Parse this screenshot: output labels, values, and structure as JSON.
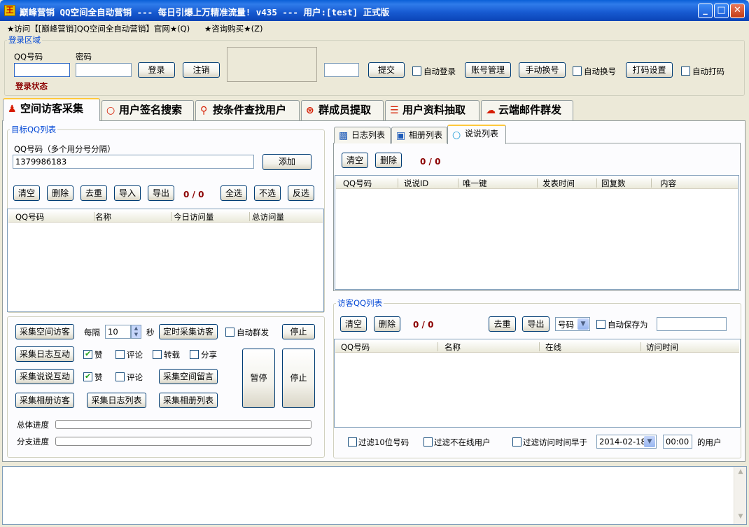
{
  "window": {
    "title": "巅峰营销 QQ空间全自动营销 --- 每日引爆上万精准流量! v435 --- 用户:[test] 正式版",
    "minimize": "_",
    "maximize": "□",
    "close": "✕"
  },
  "menu": {
    "item1": "★访问【[巅峰营销]QQ空间全自动营销】官网★(Q)",
    "item2": "★咨询购买★(Z)"
  },
  "login": {
    "group_title": "登录区域",
    "qq_label": "QQ号码",
    "qq_value": "",
    "password_label": "密码",
    "password_value": "",
    "login_btn": "登录",
    "logout_btn": "注销",
    "status": "登录状态",
    "captcha_value": "",
    "submit_btn": "提交",
    "auto_login": "自动登录",
    "account_mgmt": "账号管理",
    "manual_switch": "手动换号",
    "auto_switch": "自动换号",
    "captcha_settings": "打码设置",
    "auto_captcha": "自动打码"
  },
  "tabs": [
    {
      "label": "空间访客采集",
      "icon": "person-icon"
    },
    {
      "label": "用户签名搜索",
      "icon": "bubble-icon"
    },
    {
      "label": "按条件查找用户",
      "icon": "search-icon"
    },
    {
      "label": "群成员提取",
      "icon": "group-icon"
    },
    {
      "label": "用户资料抽取",
      "icon": "list-icon"
    },
    {
      "label": "云端邮件群发",
      "icon": "cloud-mail-icon"
    }
  ],
  "target": {
    "group_title": "目标QQ列表",
    "hint": "QQ号码（多个用分号分隔）",
    "input_value": "1379986183",
    "add_btn": "添加",
    "clear": "清空",
    "delete": "删除",
    "dedupe": "去重",
    "import": "导入",
    "export": "导出",
    "count": "0 / 0",
    "select_all": "全选",
    "select_none": "不选",
    "invert": "反选",
    "columns": [
      "QQ号码",
      "名称",
      "今日访问量",
      "总访问量"
    ]
  },
  "actions": {
    "collect_visitors": "采集空间访客",
    "every": "每隔",
    "interval": "10",
    "seconds": "秒",
    "timed_collect": "定时采集访客",
    "auto_mass": "自动群发",
    "stop1": "停止",
    "collect_blog": "采集日志互动",
    "like1": "赞",
    "comment1": "评论",
    "repost": "转载",
    "share": "分享",
    "collect_talk": "采集说说互动",
    "like2": "赞",
    "comment2": "评论",
    "collect_msg": "采集空间留言",
    "pause": "暂停",
    "stop2": "停止",
    "collect_album": "采集相册访客",
    "collect_blog_list": "采集日志列表",
    "collect_album_list": "采集相册列表",
    "total_progress": "总体进度",
    "branch_progress": "分支进度",
    "total_progress_value": 0,
    "branch_progress_value": 0
  },
  "right_tabs": [
    {
      "label": "日志列表",
      "icon": "blog-icon"
    },
    {
      "label": "相册列表",
      "icon": "camera-icon"
    },
    {
      "label": "说说列表",
      "icon": "talk-icon"
    }
  ],
  "talk": {
    "clear": "清空",
    "delete": "删除",
    "count": "0 / 0",
    "columns": [
      "QQ号码",
      "说说ID",
      "唯一键",
      "发表时间",
      "回复数",
      "内容"
    ]
  },
  "visitors": {
    "group_title": "访客QQ列表",
    "clear": "清空",
    "delete": "删除",
    "count": "0 / 0",
    "dedupe": "去重",
    "export": "导出",
    "type_select": "号码",
    "auto_save": "自动保存为",
    "save_path": "",
    "columns": [
      "QQ号码",
      "名称",
      "在线",
      "访问时间"
    ],
    "filter_10": "过滤10位号码",
    "filter_offline": "过滤不在线用户",
    "filter_time": "过滤访问时间早于",
    "date": "2014-02-18",
    "time": "00:00",
    "users_suffix": "的用户"
  },
  "log": {
    "text": ""
  },
  "colors": {
    "titlebar": "#0B52D6",
    "accent_blue": "#0046D5",
    "counter_red": "#8B0000",
    "tab_highlight": "#FFC83C"
  }
}
